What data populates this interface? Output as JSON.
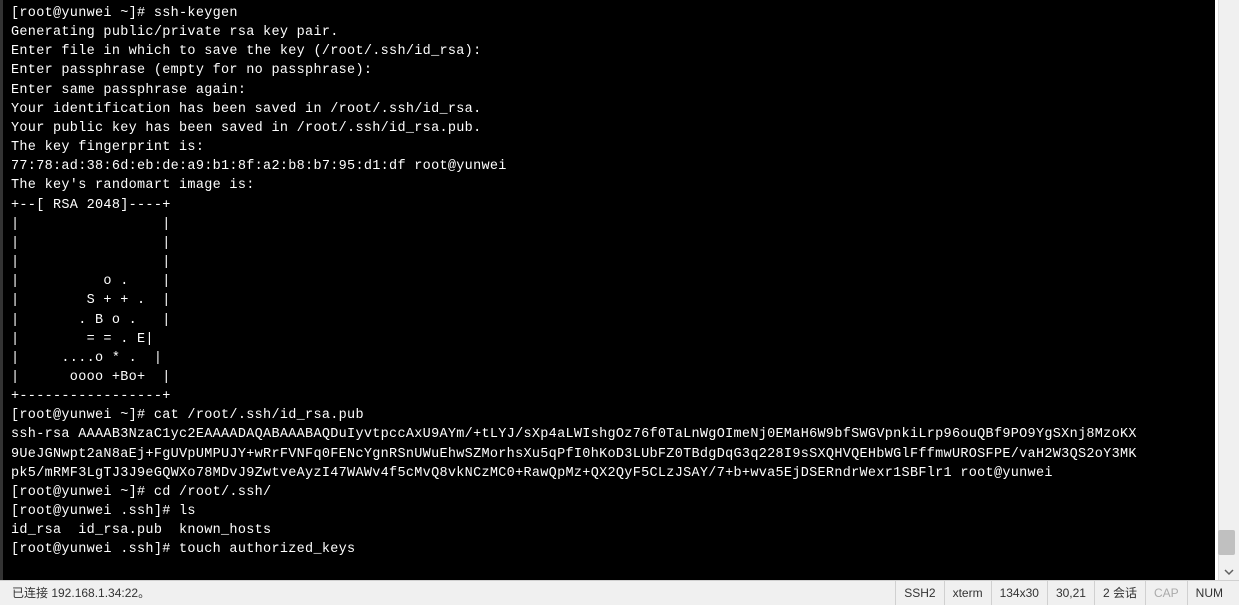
{
  "terminal": {
    "lines": [
      "[root@yunwei ~]# ssh-keygen",
      "Generating public/private rsa key pair.",
      "Enter file in which to save the key (/root/.ssh/id_rsa):",
      "Enter passphrase (empty for no passphrase):",
      "Enter same passphrase again:",
      "Your identification has been saved in /root/.ssh/id_rsa.",
      "Your public key has been saved in /root/.ssh/id_rsa.pub.",
      "The key fingerprint is:",
      "77:78:ad:38:6d:eb:de:a9:b1:8f:a2:b8:b7:95:d1:df root@yunwei",
      "The key's randomart image is:",
      "+--[ RSA 2048]----+",
      "|                 |",
      "|                 |",
      "|                 |",
      "|          o .    |",
      "|        S + + .  |",
      "|       . B o .   |",
      "|        = = . E|",
      "|     ....o * .  |",
      "|      oooo +Bo+  |",
      "+-----------------+",
      "[root@yunwei ~]# cat /root/.ssh/id_rsa.pub",
      "ssh-rsa AAAAB3NzaC1yc2EAAAADAQABAAABAQDuIyvtpccAxU9AYm/+tLYJ/sXp4aLWIshgOz76f0TaLnWgOImeNj0EMaH6W9bfSWGVpnkiLrp96ouQBf9PO9YgSXnj8MzoKX",
      "9UeJGNwpt2aN8aEj+FgUVpUMPUJY+wRrFVNFq0FENcYgnRSnUWuEhwSZMorhsXu5qPfI0hKoD3LUbFZ0TBdgDqG3q228I9sSXQHVQEHbWGlFffmwUROSFPE/vaH2W3QS2oY3MK",
      "pk5/mRMF3LgTJ3J9eGQWXo78MDvJ9ZwtveAyzI47WAWv4f5cMvQ8vkNCzMC0+RawQpMz+QX2QyF5CLzJSAY/7+b+wva5EjDSERndrWexr1SBFlr1 root@yunwei",
      "[root@yunwei ~]# cd /root/.ssh/",
      "[root@yunwei .ssh]# ls",
      "id_rsa  id_rsa.pub  known_hosts",
      "[root@yunwei .ssh]# touch authorized_keys"
    ]
  },
  "status": {
    "connected": "已连接 192.168.1.34:22。",
    "protocol": "SSH2",
    "term": "xterm",
    "size": "134x30",
    "cursor": "30,21",
    "sessions": "2 会话",
    "cap": "CAP",
    "num": "NUM"
  }
}
